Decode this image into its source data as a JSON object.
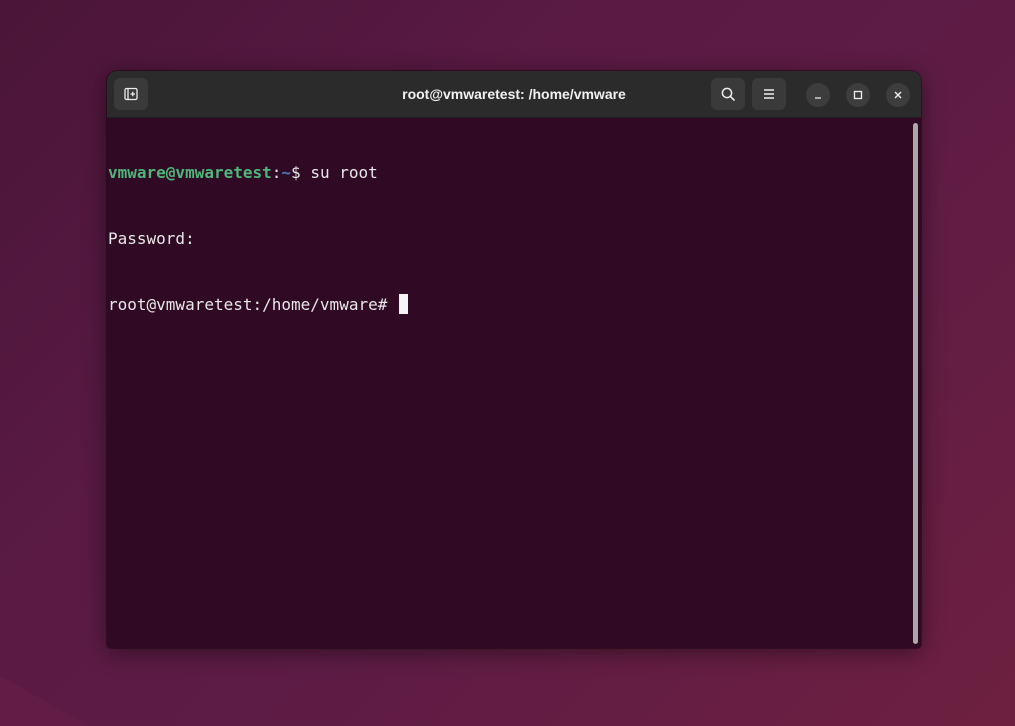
{
  "window": {
    "title": "root@vmwaretest: /home/vmware"
  },
  "headerbar": {
    "icons": {
      "new_tab": "new-tab-icon",
      "search": "search-icon",
      "menu": "hamburger-menu-icon",
      "minimize": "minimize-icon",
      "maximize": "maximize-icon",
      "close": "close-icon"
    }
  },
  "terminal": {
    "lines": [
      {
        "user_host": "vmware@vmwaretest",
        "sep": ":",
        "path": "~",
        "prompt": "$ ",
        "command": "su root"
      },
      {
        "text": "Password:"
      },
      {
        "text": "root@vmwaretest:/home/vmware# "
      }
    ]
  },
  "colors": {
    "terminal_bg": "#300a24",
    "prompt_user": "#4fb57a",
    "prompt_path": "#4a7ab8",
    "text": "#e8e8e8",
    "headerbar": "#2b2b2b"
  }
}
